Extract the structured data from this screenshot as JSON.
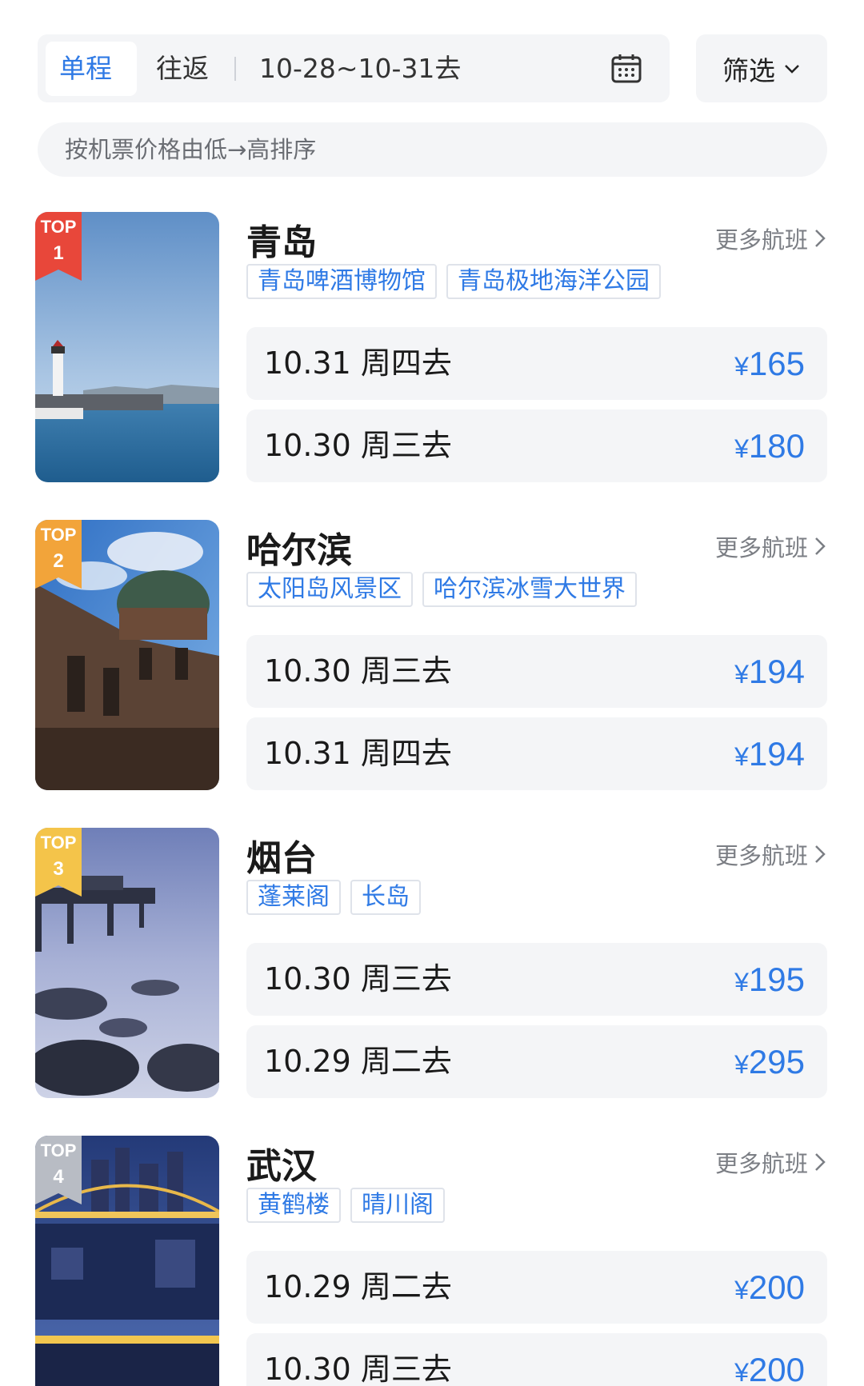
{
  "header": {
    "tabs": [
      "单程",
      "往返"
    ],
    "active_tab": "单程",
    "date_range": "10-28~10-31去",
    "filter_label": "筛选",
    "sort_label": "按机票价格由低→高排序"
  },
  "more_flights_label": "更多航班",
  "currency": "¥",
  "colors": {
    "accent": "#2f7ae5",
    "badge_1": "#e8473a",
    "badge_2": "#f2a43a",
    "badge_3": "#f4c44a",
    "badge_4": "#b8bcc4"
  },
  "destinations": [
    {
      "rank_label": "TOP",
      "rank": "1",
      "city": "青岛",
      "tags": [
        "青岛啤酒博物馆",
        "青岛极地海洋公园"
      ],
      "flights": [
        {
          "date": "10.31  周四去",
          "price": "165"
        },
        {
          "date": "10.30  周三去",
          "price": "180"
        }
      ]
    },
    {
      "rank_label": "TOP",
      "rank": "2",
      "city": "哈尔滨",
      "tags": [
        "太阳岛风景区",
        "哈尔滨冰雪大世界"
      ],
      "flights": [
        {
          "date": "10.30  周三去",
          "price": "194"
        },
        {
          "date": "10.31  周四去",
          "price": "194"
        }
      ]
    },
    {
      "rank_label": "TOP",
      "rank": "3",
      "city": "烟台",
      "tags": [
        "蓬莱阁",
        "长岛"
      ],
      "flights": [
        {
          "date": "10.30  周三去",
          "price": "195"
        },
        {
          "date": "10.29  周二去",
          "price": "295"
        }
      ]
    },
    {
      "rank_label": "TOP",
      "rank": "4",
      "city": "武汉",
      "tags": [
        "黄鹤楼",
        "晴川阁"
      ],
      "flights": [
        {
          "date": "10.29  周二去",
          "price": "200"
        },
        {
          "date": "10.30  周三去",
          "price": "200"
        }
      ]
    }
  ]
}
